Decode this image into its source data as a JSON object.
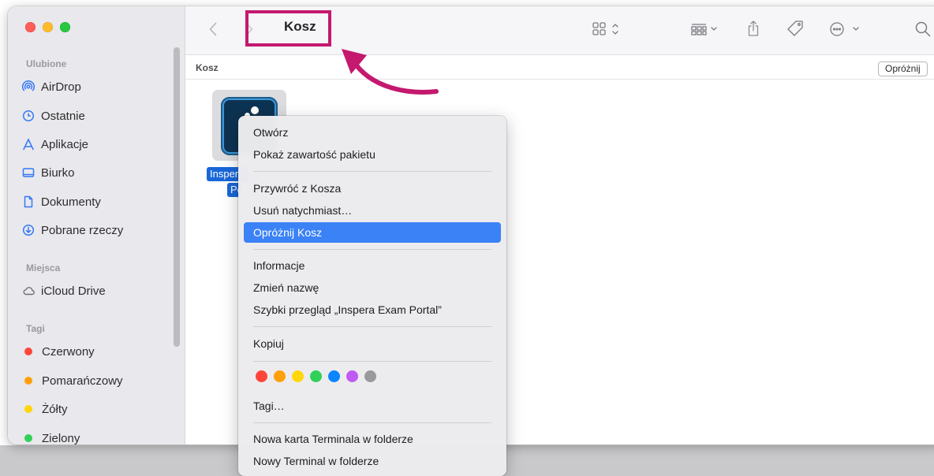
{
  "window": {
    "title": "Kosz"
  },
  "pathbar": {
    "label": "Kosz",
    "empty_button": "Opróżnij"
  },
  "sidebar": {
    "favorites_header": "Ulubione",
    "favorites": [
      {
        "label": "AirDrop",
        "icon": "airdrop-icon"
      },
      {
        "label": "Ostatnie",
        "icon": "clock-icon"
      },
      {
        "label": "Aplikacje",
        "icon": "applications-icon"
      },
      {
        "label": "Biurko",
        "icon": "desktop-icon"
      },
      {
        "label": "Dokumenty",
        "icon": "document-icon"
      },
      {
        "label": "Pobrane rzeczy",
        "icon": "download-icon"
      }
    ],
    "places_header": "Miejsca",
    "places": [
      {
        "label": "iCloud Drive",
        "icon": "cloud-icon"
      }
    ],
    "tags_header": "Tagi",
    "tags": [
      {
        "label": "Czerwony",
        "color": "#ff453a"
      },
      {
        "label": "Pomarańczowy",
        "color": "#ff9f0a"
      },
      {
        "label": "Żółty",
        "color": "#ffd60a"
      },
      {
        "label": "Zielony",
        "color": "#30d158"
      }
    ]
  },
  "file": {
    "label_line1": "Inspera Exam Portal",
    "label_line2": "Portal"
  },
  "context_menu": {
    "open": "Otwórz",
    "show_package": "Pokaż zawartość pakietu",
    "restore": "Przywróć z Kosza",
    "delete_now": "Usuń natychmiast…",
    "empty_trash": "Opróżnij Kosz",
    "info": "Informacje",
    "rename": "Zmień nazwę",
    "quick_look": "Szybki przegląd „Inspera Exam Portal”",
    "copy": "Kopiuj",
    "tag_colors": [
      "#ff453a",
      "#ff9f0a",
      "#ffd60a",
      "#30d158",
      "#0a84ff",
      "#bf5af2",
      "#98989d"
    ],
    "tags": "Tagi…",
    "new_terminal_tab": "Nowa karta Terminala w folderze",
    "new_terminal": "Nowy Terminal w folderze"
  },
  "colors": {
    "highlight": "#c4196f",
    "selection": "#3b82f6"
  }
}
